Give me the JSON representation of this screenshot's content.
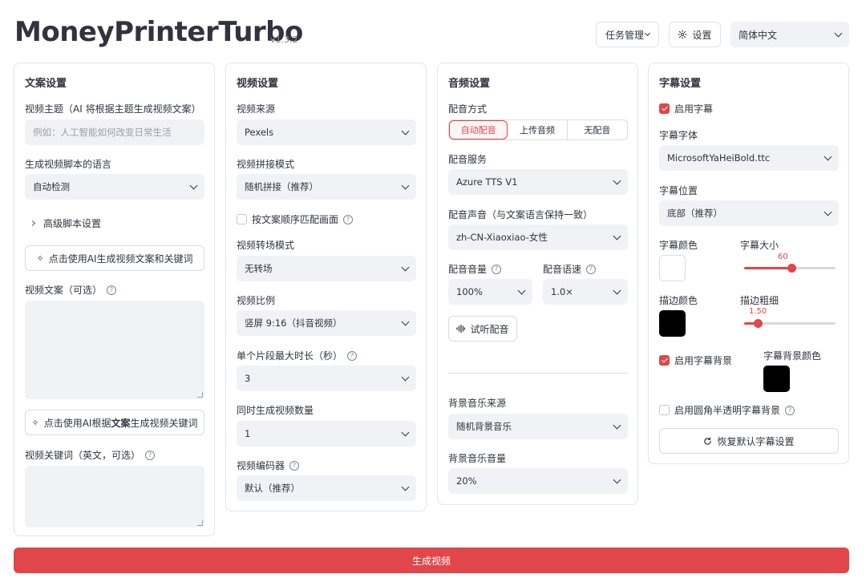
{
  "app": {
    "title": "MoneyPrinterTurbo",
    "version": "v1.3.2"
  },
  "header": {
    "task_mgmt": "任务管理",
    "settings": "设置",
    "language": "简体中文"
  },
  "script_panel": {
    "title": "文案设置",
    "subject_label": "视频主题（AI 将根据主题生成视频文案）",
    "subject_placeholder": "例如：人工智能如何改变日常生活",
    "lang_label": "生成视频脚本的语言",
    "lang_value": "自动检测",
    "advanced": "高级脚本设置",
    "gen_script_btn": "点击使用AI生成视频文案和关键词",
    "script_label": "视频文案（可选）",
    "gen_keywords_btn_pre": "点击使用AI根据",
    "gen_keywords_btn_bold": "文案",
    "gen_keywords_btn_post": "生成视频关键词",
    "keywords_label": "视频关键词（英文，可选）"
  },
  "video_panel": {
    "title": "视频设置",
    "source_label": "视频来源",
    "source_value": "Pexels",
    "concat_label": "视频拼接模式",
    "concat_value": "随机拼接（推荐）",
    "match_order_label": "按文案顺序匹配画面",
    "transition_label": "视频转场模式",
    "transition_value": "无转场",
    "ratio_label": "视频比例",
    "ratio_value": "竖屏 9:16（抖音视频）",
    "clip_label": "单个片段最大时长（秒）",
    "clip_value": "3",
    "count_label": "同时生成视频数量",
    "count_value": "1",
    "codec_label": "视频编码器",
    "codec_value": "默认（推荐）"
  },
  "audio_panel": {
    "title": "音频设置",
    "mode_label": "配音方式",
    "modes": [
      "自动配音",
      "上传音频",
      "无配音"
    ],
    "service_label": "配音服务",
    "service_value": "Azure TTS V1",
    "voice_label": "配音声音（与文案语言保持一致）",
    "voice_value": "zh-CN-Xiaoxiao-女性",
    "volume_label": "配音音量",
    "volume_value": "100%",
    "speed_label": "配音语速",
    "speed_value": "1.0×",
    "preview_btn": "试听配音",
    "bgm_source_label": "背景音乐来源",
    "bgm_source_value": "随机背景音乐",
    "bgm_volume_label": "背景音乐音量",
    "bgm_volume_value": "20%"
  },
  "subtitle_panel": {
    "title": "字幕设置",
    "enable_label": "启用字幕",
    "font_label": "字幕字体",
    "font_value": "MicrosoftYaHeiBold.ttc",
    "position_label": "字幕位置",
    "position_value": "底部（推荐）",
    "color_label": "字幕颜色",
    "color_value": "#ffffff",
    "size_label": "字幕大小",
    "size_value": "60",
    "size_fraction": 0.52,
    "stroke_color_label": "描边颜色",
    "stroke_color_value": "#000000",
    "stroke_width_label": "描边粗细",
    "stroke_width_value": "1.50",
    "stroke_width_fraction": 0.15,
    "bg_enable_label": "启用字幕背景",
    "bg_color_label": "字幕背景颜色",
    "bg_color_value": "#000000",
    "rounded_label": "启用圆角半透明字幕背景",
    "reset_btn": "恢复默认字幕设置"
  },
  "generate_btn": "生成视频",
  "colors": {
    "accent": "#e0464a",
    "input_bg": "#f0f2f6"
  }
}
